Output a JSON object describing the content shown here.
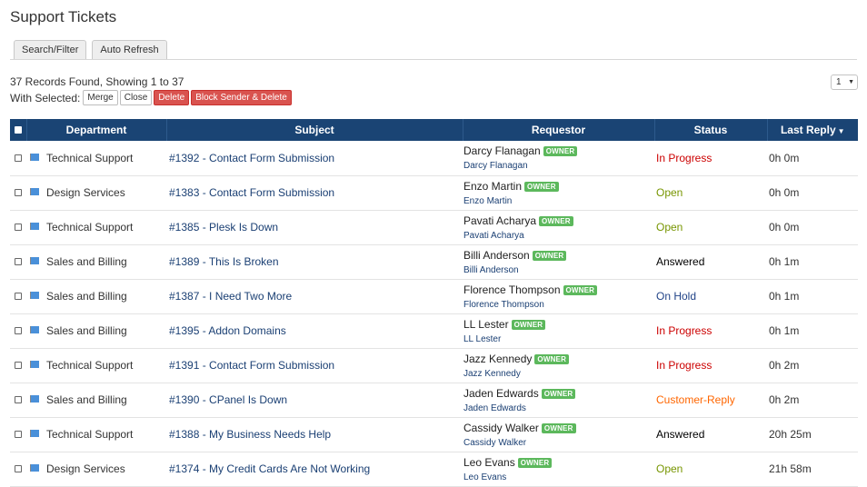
{
  "page": {
    "title": "Support Tickets"
  },
  "tabs": [
    {
      "label": "Search/Filter"
    },
    {
      "label": "Auto Refresh"
    }
  ],
  "summary": {
    "records_text": "37 Records Found, Showing 1 to 37"
  },
  "bulk_actions": {
    "label": "With Selected:",
    "merge": "Merge",
    "close": "Close",
    "delete": "Delete",
    "block_delete": "Block Sender & Delete"
  },
  "pagination": {
    "current_page": "1",
    "caret": "▼"
  },
  "table": {
    "headers": {
      "department": "Department",
      "subject": "Subject",
      "requestor": "Requestor",
      "status": "Status",
      "last_reply": "Last Reply",
      "sort_indicator": "▼"
    },
    "owner_badge": "OWNER",
    "rows": [
      {
        "department": "Technical Support",
        "subject": "#1392 - Contact Form Submission",
        "requestor": "Darcy Flanagan",
        "requestor_sub": "Darcy Flanagan",
        "status": "In Progress",
        "last_reply": "0h 0m"
      },
      {
        "department": "Design Services",
        "subject": "#1383 - Contact Form Submission",
        "requestor": "Enzo Martin",
        "requestor_sub": "Enzo Martin",
        "status": "Open",
        "last_reply": "0h 0m"
      },
      {
        "department": "Technical Support",
        "subject": "#1385 - Plesk Is Down",
        "requestor": "Pavati Acharya",
        "requestor_sub": "Pavati Acharya",
        "status": "Open",
        "last_reply": "0h 0m"
      },
      {
        "department": "Sales and Billing",
        "subject": "#1389 - This Is Broken",
        "requestor": "Billi Anderson",
        "requestor_sub": "Billi Anderson",
        "status": "Answered",
        "last_reply": "0h 1m"
      },
      {
        "department": "Sales and Billing",
        "subject": "#1387 - I Need Two More",
        "requestor": "Florence Thompson",
        "requestor_sub": "Florence Thompson",
        "status": "On Hold",
        "last_reply": "0h 1m"
      },
      {
        "department": "Sales and Billing",
        "subject": "#1395 - Addon Domains",
        "requestor": "LL Lester",
        "requestor_sub": "LL Lester",
        "status": "In Progress",
        "last_reply": "0h 1m"
      },
      {
        "department": "Technical Support",
        "subject": "#1391 - Contact Form Submission",
        "requestor": "Jazz Kennedy",
        "requestor_sub": "Jazz Kennedy",
        "status": "In Progress",
        "last_reply": "0h 2m"
      },
      {
        "department": "Sales and Billing",
        "subject": "#1390 - CPanel Is Down",
        "requestor": "Jaden Edwards",
        "requestor_sub": "Jaden Edwards",
        "status": "Customer-Reply",
        "last_reply": "0h 2m"
      },
      {
        "department": "Technical Support",
        "subject": "#1388 - My Business Needs Help",
        "requestor": "Cassidy Walker",
        "requestor_sub": "Cassidy Walker",
        "status": "Answered",
        "last_reply": "20h 25m"
      },
      {
        "department": "Design Services",
        "subject": "#1374 - My Credit Cards Are Not Working",
        "requestor": "Leo Evans",
        "requestor_sub": "Leo Evans",
        "status": "Open",
        "last_reply": "21h 58m"
      }
    ]
  },
  "colors": {
    "header_bg": "#1a4474",
    "link": "#1a3f73",
    "owner_badge": "#5cb85c",
    "danger_button": "#d9534f",
    "status": {
      "In Progress": "#cc0000",
      "Open": "#779500",
      "Answered": "#000000",
      "On Hold": "#224488",
      "Customer-Reply": "#ff6600"
    }
  },
  "icons": {
    "department": "flag-icon"
  }
}
